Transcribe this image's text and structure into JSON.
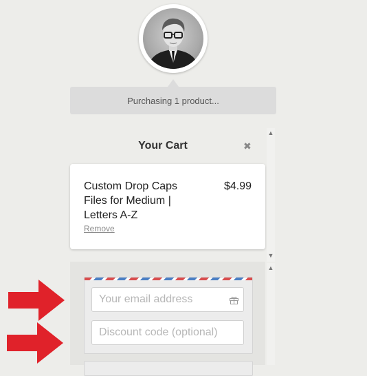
{
  "status": {
    "text": "Purchasing 1 product..."
  },
  "cart": {
    "title": "Your Cart",
    "items": [
      {
        "name": "Custom Drop Caps Files for Medium | Letters A-Z",
        "price": "$4.99",
        "remove_label": "Remove"
      }
    ]
  },
  "form": {
    "email": {
      "placeholder": "Your email address",
      "value": ""
    },
    "discount": {
      "placeholder": "Discount code (optional)",
      "value": ""
    }
  },
  "icons": {
    "close": "close-icon",
    "gift": "gift-icon",
    "scroll_up": "scroll-up-icon",
    "scroll_down": "scroll-down-icon"
  },
  "colors": {
    "annotation_arrow": "#e0222a",
    "airmail_red": "#d94c4c",
    "airmail_blue": "#4a7fc4"
  }
}
